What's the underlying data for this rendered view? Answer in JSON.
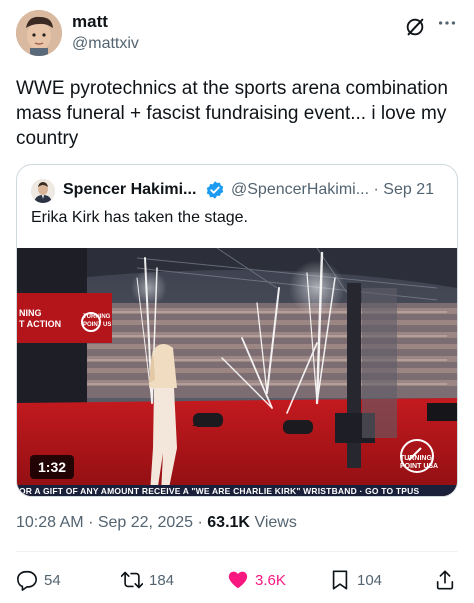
{
  "author": {
    "name": "matt",
    "handle": "@mattxiv"
  },
  "tweet": {
    "text": "WWE pyrotechnics at the sports arena combination mass funeral + fascist fundraising event... i love my country"
  },
  "quote": {
    "name": "Spencer Hakimi...",
    "handle": "@SpencerHakimi...",
    "separator": "·",
    "date": "Sep 21",
    "text": "Erika Kirk has taken the stage.",
    "video": {
      "duration": "1:32",
      "ticker": "OR A GIFT OF ANY AMOUNT RECEIVE A \"WE ARE CHARLIE KIRK\" WRISTBAND · GO TO TPUS",
      "banner_left": "NING\nT ACTION",
      "banner_brand": "TURNING\nPOINT US",
      "watermark": "TURNING\nPOINT USA"
    }
  },
  "meta": {
    "time": "10:28 AM",
    "date": "Sep 22, 2025",
    "views_count": "63.1K",
    "views_label": "Views"
  },
  "actions": {
    "replies": "54",
    "reposts": "184",
    "likes": "3.6K",
    "bookmarks": "104"
  },
  "colors": {
    "like": "#f91880",
    "verified": "#1d9bf0",
    "stage_red": "#b3151b"
  },
  "icons": [
    "grok-icon",
    "more-icon",
    "verified-badge-icon",
    "reply-icon",
    "repost-icon",
    "like-icon",
    "bookmark-icon",
    "share-icon"
  ]
}
